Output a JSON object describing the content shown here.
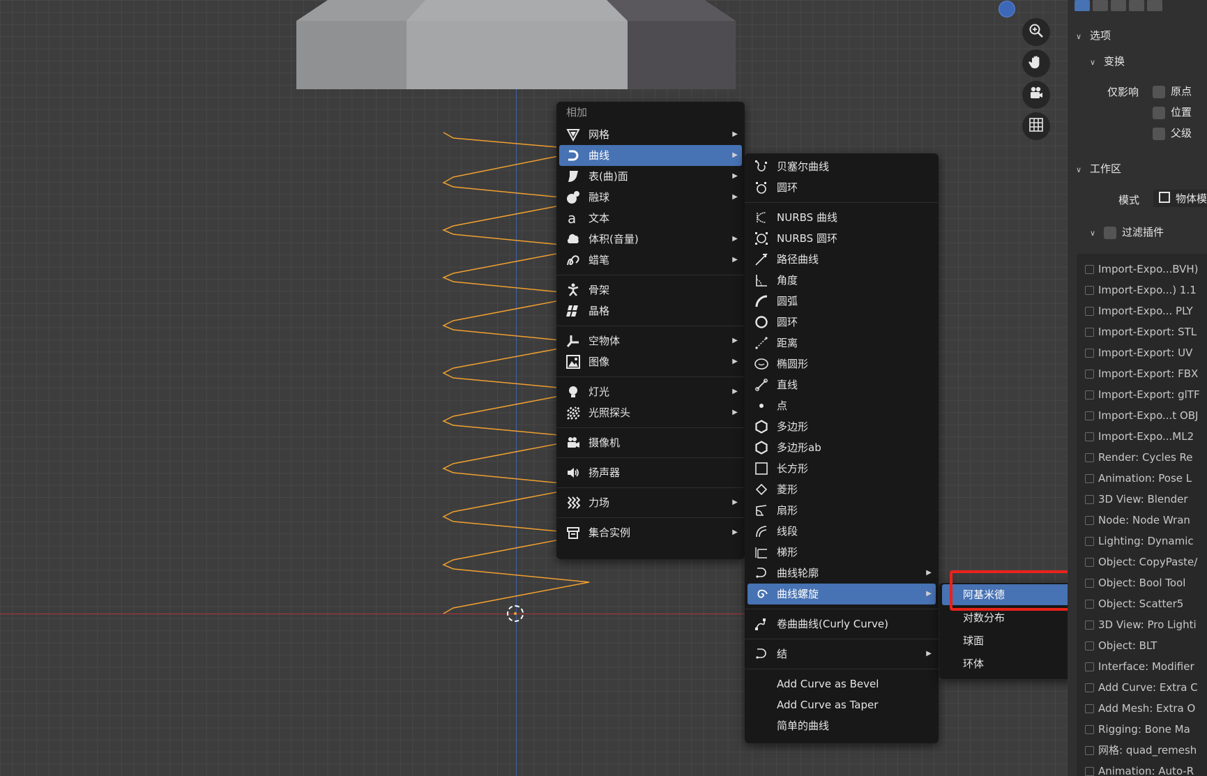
{
  "add_menu": {
    "title": "相加",
    "items": [
      {
        "label": "网格",
        "icon": "mesh-icon",
        "submenu": true
      },
      {
        "label": "曲线",
        "icon": "curve-icon",
        "submenu": true,
        "active": true
      },
      {
        "label": "表(曲)面",
        "icon": "surface-icon",
        "submenu": true
      },
      {
        "label": "融球",
        "icon": "metaball-icon",
        "submenu": true
      },
      {
        "label": "文本",
        "icon": "text-icon",
        "submenu": false
      },
      {
        "label": "体积(音量)",
        "icon": "volume-icon",
        "submenu": true
      },
      {
        "label": "蜡笔",
        "icon": "grease-pencil-icon",
        "submenu": true
      },
      {
        "label": "骨架",
        "icon": "armature-icon",
        "submenu": false
      },
      {
        "label": "晶格",
        "icon": "lattice-icon",
        "submenu": false
      },
      {
        "label": "空物体",
        "icon": "empty-icon",
        "submenu": true
      },
      {
        "label": "图像",
        "icon": "image-icon",
        "submenu": true
      },
      {
        "label": "灯光",
        "icon": "light-icon",
        "submenu": true
      },
      {
        "label": "光照探头",
        "icon": "light-probe-icon",
        "submenu": true
      },
      {
        "label": "摄像机",
        "icon": "camera-icon",
        "submenu": false
      },
      {
        "label": "扬声器",
        "icon": "speaker-icon",
        "submenu": false
      },
      {
        "label": "力场",
        "icon": "force-field-icon",
        "submenu": true
      },
      {
        "label": "集合实例",
        "icon": "collection-instance-icon",
        "submenu": true
      }
    ]
  },
  "curve_menu": {
    "items": [
      {
        "label": "贝塞尔曲线",
        "icon": "bezier-curve-icon"
      },
      {
        "label": "圆环",
        "icon": "bezier-circle-icon"
      },
      {
        "label": "NURBS 曲线",
        "icon": "nurbs-curve-icon"
      },
      {
        "label": "NURBS 圆环",
        "icon": "nurbs-circle-icon"
      },
      {
        "label": "路径曲线",
        "icon": "path-curve-icon"
      },
      {
        "label": "角度",
        "icon": "angle-icon"
      },
      {
        "label": "圆弧",
        "icon": "arc-icon"
      },
      {
        "label": "圆环",
        "icon": "circle-icon"
      },
      {
        "label": "距离",
        "icon": "distance-icon"
      },
      {
        "label": "椭圆形",
        "icon": "ellipse-icon"
      },
      {
        "label": "直线",
        "icon": "line-icon"
      },
      {
        "label": "点",
        "icon": "point-icon"
      },
      {
        "label": "多边形",
        "icon": "polygon-icon"
      },
      {
        "label": "多边形ab",
        "icon": "polygon-ab-icon"
      },
      {
        "label": "长方形",
        "icon": "rectangle-icon"
      },
      {
        "label": "菱形",
        "icon": "rhomb-icon"
      },
      {
        "label": "扇形",
        "icon": "sector-icon"
      },
      {
        "label": "线段",
        "icon": "segment-icon"
      },
      {
        "label": "梯形",
        "icon": "trapezoid-icon"
      },
      {
        "label": "曲线轮廓",
        "icon": "curve-profile-icon",
        "submenu": true
      },
      {
        "label": "曲线螺旋",
        "icon": "curve-spiral-icon",
        "submenu": true,
        "active": true
      },
      {
        "label": "卷曲曲线(Curly Curve)",
        "icon": "curly-curve-icon"
      },
      {
        "label": "结",
        "icon": "knot-icon",
        "submenu": true
      },
      {
        "label": "Add Curve as Bevel",
        "icon": ""
      },
      {
        "label": "Add Curve as Taper",
        "icon": ""
      },
      {
        "label": "简单的曲线",
        "icon": ""
      }
    ]
  },
  "spiral_menu": {
    "items": [
      {
        "label": "阿基米德",
        "active": true
      },
      {
        "label": "对数分布"
      },
      {
        "label": "球面"
      },
      {
        "label": "环体"
      }
    ]
  },
  "nav_gizmo": {
    "buttons": [
      "zoom-icon",
      "pan-hand-icon",
      "camera-view-icon",
      "grid-ortho-icon"
    ]
  },
  "panel": {
    "options_header": "选项",
    "transform_header": "变换",
    "affect_only_label": "仅影响",
    "origin_label": "原点",
    "location_label": "位置",
    "parent_label": "父级",
    "workspace_header": "工作区",
    "mode_label": "模式",
    "mode_value": "物体模",
    "filter_addons_label": "过滤插件",
    "addons": [
      "Import-Expo...BVH)",
      "Import-Expo...) 1.1",
      "Import-Expo... PLY",
      "Import-Export: STL",
      "Import-Export: UV",
      "Import-Export: FBX",
      "Import-Export: glTF",
      "Import-Expo...t OBJ",
      "Import-Expo...ML2",
      "Render: Cycles Re",
      "Animation: Pose L",
      "3D View: Blender",
      "Node: Node Wran",
      "Lighting: Dynamic",
      "Object: CopyPaste/",
      "Object: Bool Tool",
      "Object: Scatter5",
      "3D View: Pro Lighti",
      "Object: BLT",
      "Interface: Modifier",
      "Add Curve: Extra C",
      "Add Mesh: Extra O",
      "Rigging: Bone Ma",
      "网格: quad_remesh",
      "Animation: Auto-R"
    ]
  },
  "colors": {
    "accent": "#4772b3",
    "spring": "#f0a030",
    "highlight": "#e8231b"
  }
}
